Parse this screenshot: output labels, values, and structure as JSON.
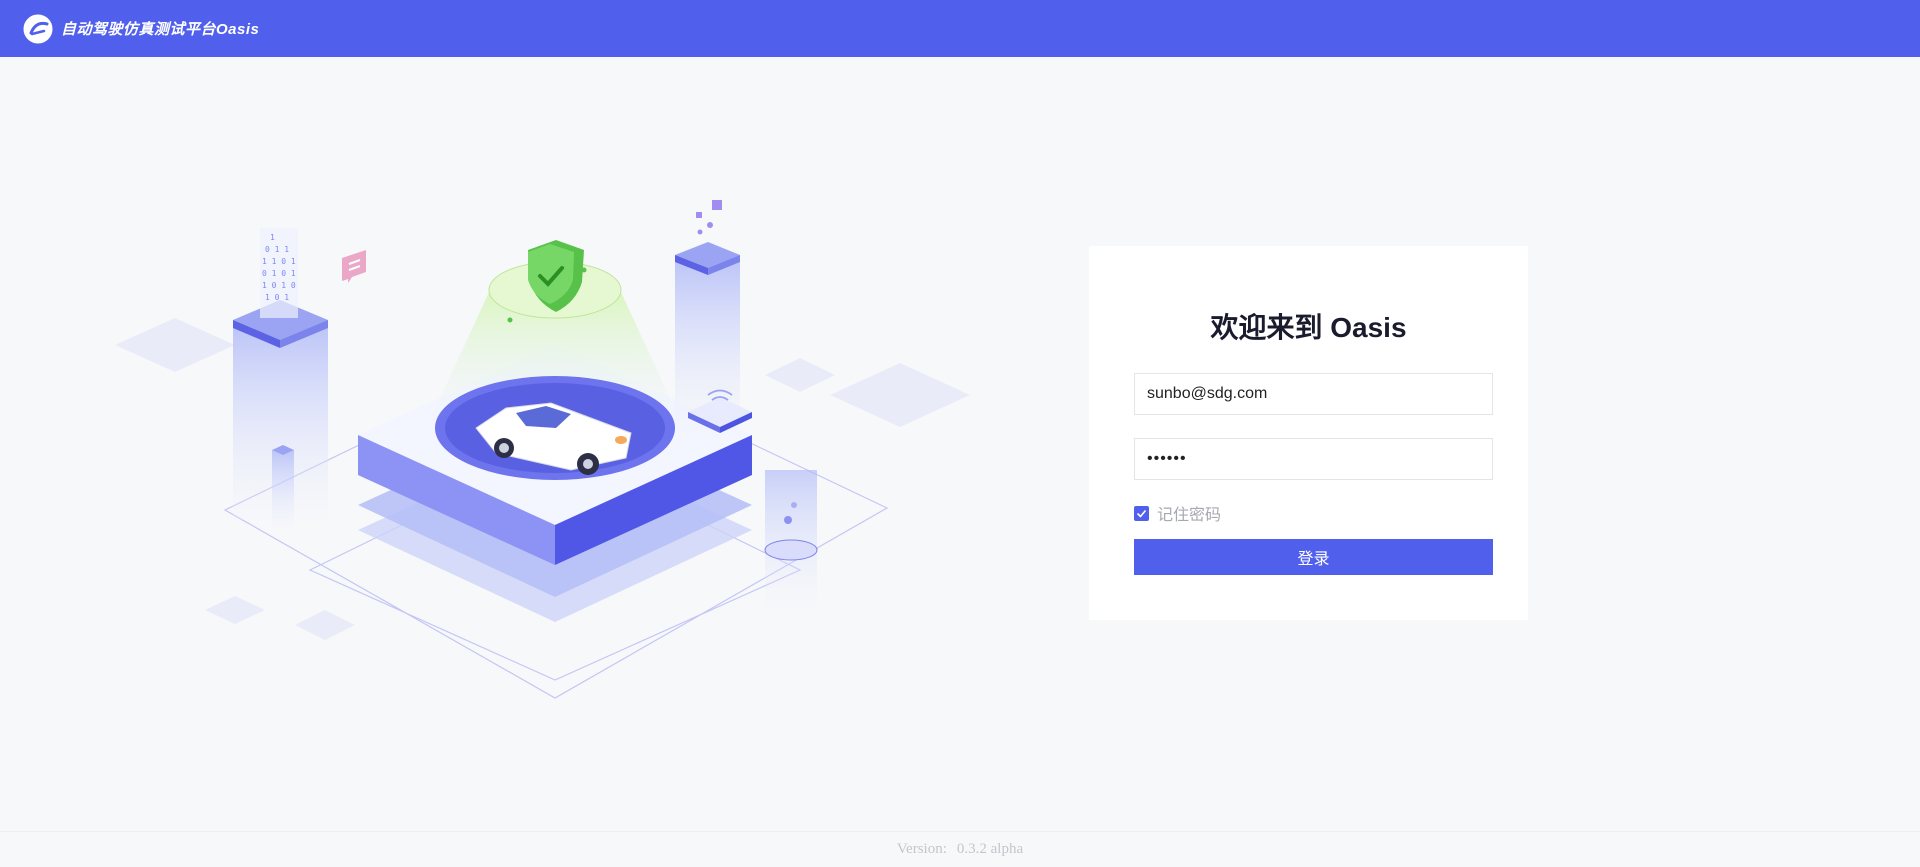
{
  "header": {
    "logo_icon": "oasis-logo-icon",
    "app_title": "自动驾驶仿真测试平台Oasis",
    "background_color": "#5160ec"
  },
  "login": {
    "title": "欢迎来到 Oasis",
    "email_value": "sunbo@sdg.com",
    "password_value": "••••••",
    "remember_checked": true,
    "remember_label": "记住密码",
    "submit_label": "登录",
    "accent_color": "#5160ec"
  },
  "illustration": {
    "icon": "autonomous-car-illustration"
  },
  "footer": {
    "version_label": "Version:",
    "version_value": "0.3.2 alpha"
  }
}
